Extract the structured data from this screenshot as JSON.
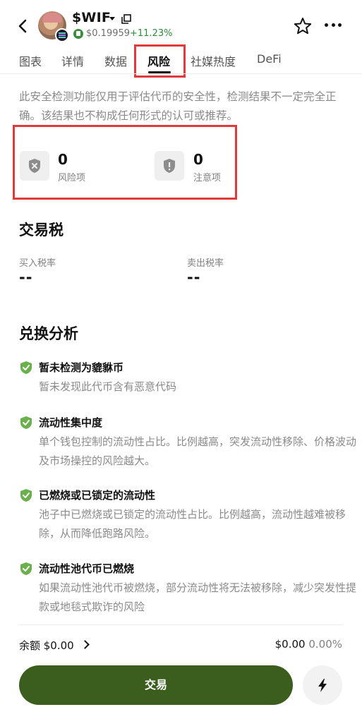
{
  "header": {
    "token_name": "$WIF",
    "price": "$0.19959",
    "change": "+11.23%",
    "icons": [
      "back-icon",
      "copy-icon",
      "star-icon",
      "more-icon"
    ]
  },
  "tabs": [
    {
      "label": "图表"
    },
    {
      "label": "详情"
    },
    {
      "label": "数据"
    },
    {
      "label": "风险"
    },
    {
      "label": "社媒热度"
    },
    {
      "label": "DeFi"
    }
  ],
  "disclaimer": "此安全检测功能仅用于评估代币的安全性，检测结果不一定完全正确。该结果也不构成任何形式的认可或推荐。",
  "risk_summary": {
    "risk": {
      "count": "0",
      "label": "风险项"
    },
    "warning": {
      "count": "0",
      "label": "注意项"
    }
  },
  "tax": {
    "title": "交易税",
    "buy_label": "买入税率",
    "buy_value": "--",
    "sell_label": "卖出税率",
    "sell_value": "--"
  },
  "swap": {
    "title": "兑换分析",
    "items": [
      {
        "title": "暂未检测为貔貅币",
        "desc": "暂未发现此代币含有恶意代码"
      },
      {
        "title": "流动性集中度",
        "desc": "单个钱包控制的流动性占比。比例越高，突发流动性移除、价格波动及市场操控的风险越大。"
      },
      {
        "title": "已燃烧或已锁定的流动性",
        "desc": "池子中已燃烧或已锁定的流动性占比。比例越高，流动性越难被移除，从而降低跑路风险。"
      },
      {
        "title": "流动性池代币已燃烧",
        "desc": "如果流动性池代币被燃烧，部分流动性将无法被移除，减少突发性提款或地毯式欺诈的风险"
      }
    ]
  },
  "footer": {
    "balance_label": "余额 $0.00",
    "right_value": "$0.00",
    "right_pct": "0.00%",
    "trade_label": "交易"
  },
  "colors": {
    "accent": "#3b5e1f",
    "positive": "#2a8f38",
    "shield": "#6ab04c",
    "highlight": "#e23a3a"
  }
}
